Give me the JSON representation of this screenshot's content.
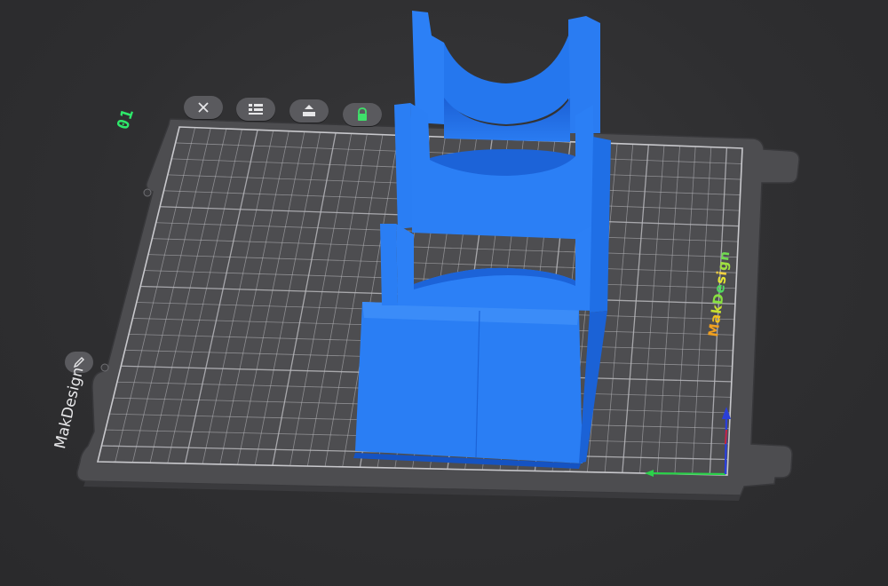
{
  "plate": {
    "number": "01",
    "name": "MakDesign",
    "texture_logo": "MakDesign"
  },
  "toolbar": {
    "buttons": [
      {
        "name": "remove-plate-button",
        "icon": "close-icon"
      },
      {
        "name": "arrange-plate-button",
        "icon": "arrange-icon"
      },
      {
        "name": "auto-orient-button",
        "icon": "auto-orient-icon"
      },
      {
        "name": "lock-plate-button",
        "icon": "lock-icon"
      }
    ]
  },
  "colors": {
    "plate": "#4d4d50",
    "grid": "#b8b8bc",
    "model": "#2378f0",
    "model_shadow": "#1a5fd0",
    "plate_number": "#2ee86a",
    "axis_x": "#2bd14a",
    "axis_y": "#c8243a",
    "axis_z": "#2a3fd8"
  }
}
